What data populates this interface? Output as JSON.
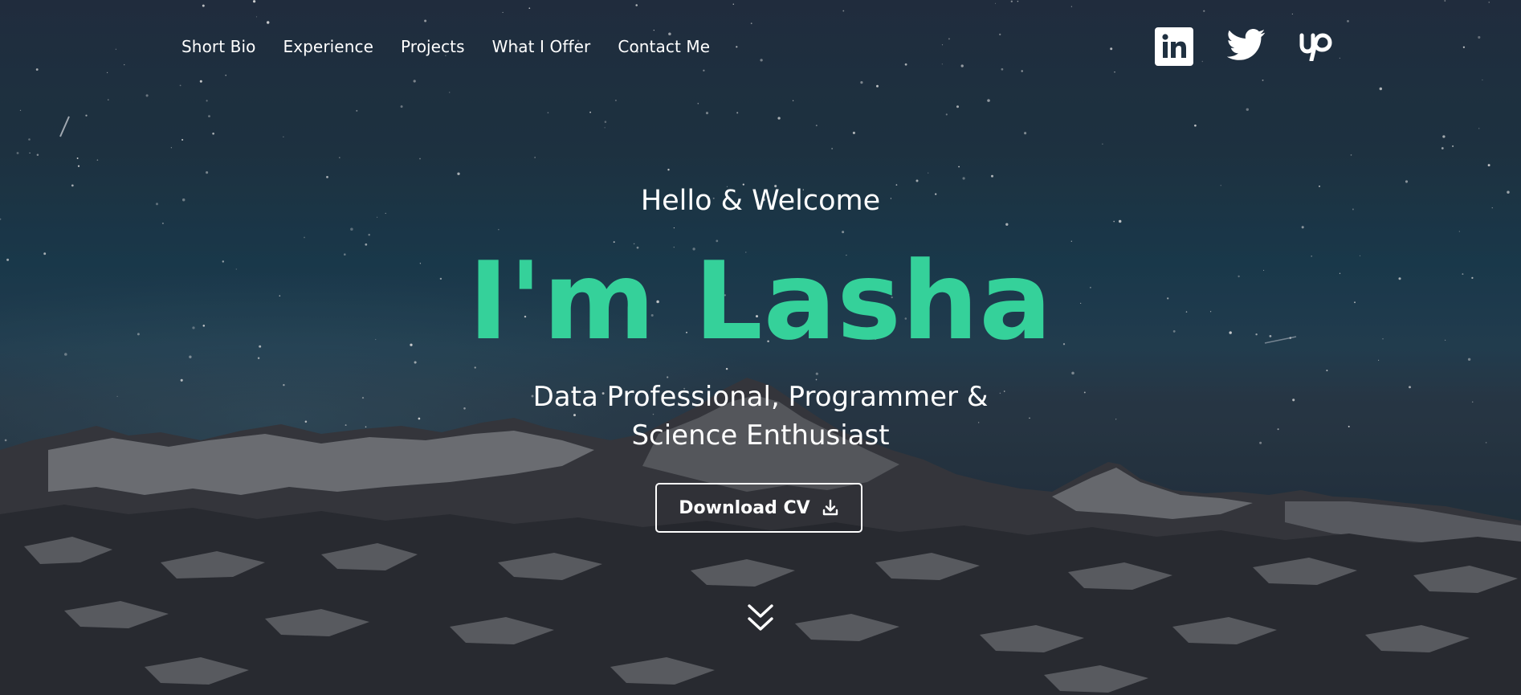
{
  "nav": {
    "items": [
      {
        "label": "Short Bio"
      },
      {
        "label": "Experience"
      },
      {
        "label": "Projects"
      },
      {
        "label": "What I Offer"
      },
      {
        "label": "Contact Me"
      }
    ]
  },
  "social": {
    "icons": [
      "linkedin-icon",
      "twitter-icon",
      "upwork-icon"
    ]
  },
  "hero": {
    "greeting": "Hello & Welcome",
    "name": "I'm Lasha",
    "tagline_line1": "Data Professional, Programmer &",
    "tagline_line2": "Science Enthusiast",
    "cv_button_label": "Download CV",
    "cv_button_icon": "download-icon",
    "scroll_icon": "double-chevron-down-icon"
  },
  "colors": {
    "accent": "#35d19a",
    "text": "#ffffff",
    "sky_top": "#253346",
    "sky_mid": "#1d4156"
  }
}
